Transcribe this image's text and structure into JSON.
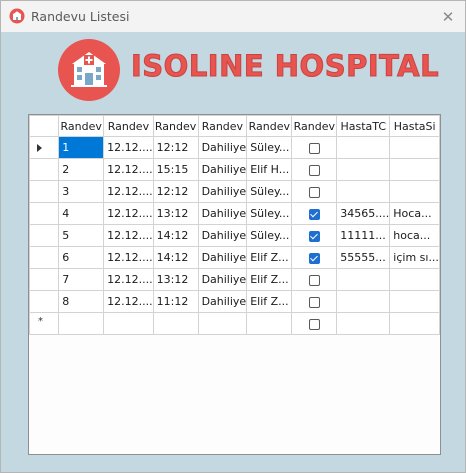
{
  "window": {
    "title": "Randevu Listesi",
    "close_symbol": "✕"
  },
  "brand": {
    "name": "ISOLINE HOSPITAL",
    "primary_color": "#e8544f"
  },
  "grid": {
    "columns": [
      "Randev",
      "Randev",
      "Randev",
      "Randev",
      "Randev",
      "Randev",
      "HastaTC",
      "HastaSi"
    ],
    "rows": [
      {
        "c1": "1",
        "c2": "12.12....",
        "c3": "12:12",
        "c4": "Dahiliye",
        "c5": "Süley...",
        "checked": false,
        "c7": "",
        "c8": ""
      },
      {
        "c1": "2",
        "c2": "12.12....",
        "c3": "15:15",
        "c4": "Dahiliye",
        "c5": "Elif H...",
        "checked": false,
        "c7": "",
        "c8": ""
      },
      {
        "c1": "3",
        "c2": "12.12....",
        "c3": "12:12",
        "c4": "Dahiliye",
        "c5": "Süley...",
        "checked": false,
        "c7": "",
        "c8": ""
      },
      {
        "c1": "4",
        "c2": "12.12....",
        "c3": "13:12",
        "c4": "Dahiliye",
        "c5": "Süley...",
        "checked": true,
        "c7": "34565....",
        "c8": "Hoca..."
      },
      {
        "c1": "5",
        "c2": "12.12....",
        "c3": "14:12",
        "c4": "Dahiliye",
        "c5": "Süley...",
        "checked": true,
        "c7": "11111...",
        "c8": "hoca..."
      },
      {
        "c1": "6",
        "c2": "12.12....",
        "c3": "14:12",
        "c4": "Dahiliye",
        "c5": "Elif Z...",
        "checked": true,
        "c7": "55555...",
        "c8": "içim sı..."
      },
      {
        "c1": "7",
        "c2": "12.12....",
        "c3": "13:12",
        "c4": "Dahiliye",
        "c5": "Elif Z...",
        "checked": false,
        "c7": "",
        "c8": ""
      },
      {
        "c1": "8",
        "c2": "12.12....",
        "c3": "11:12",
        "c4": "Dahiliye",
        "c5": "Elif Z...",
        "checked": false,
        "c7": "",
        "c8": ""
      }
    ],
    "new_row_marker": "*",
    "new_row_checked": false
  }
}
